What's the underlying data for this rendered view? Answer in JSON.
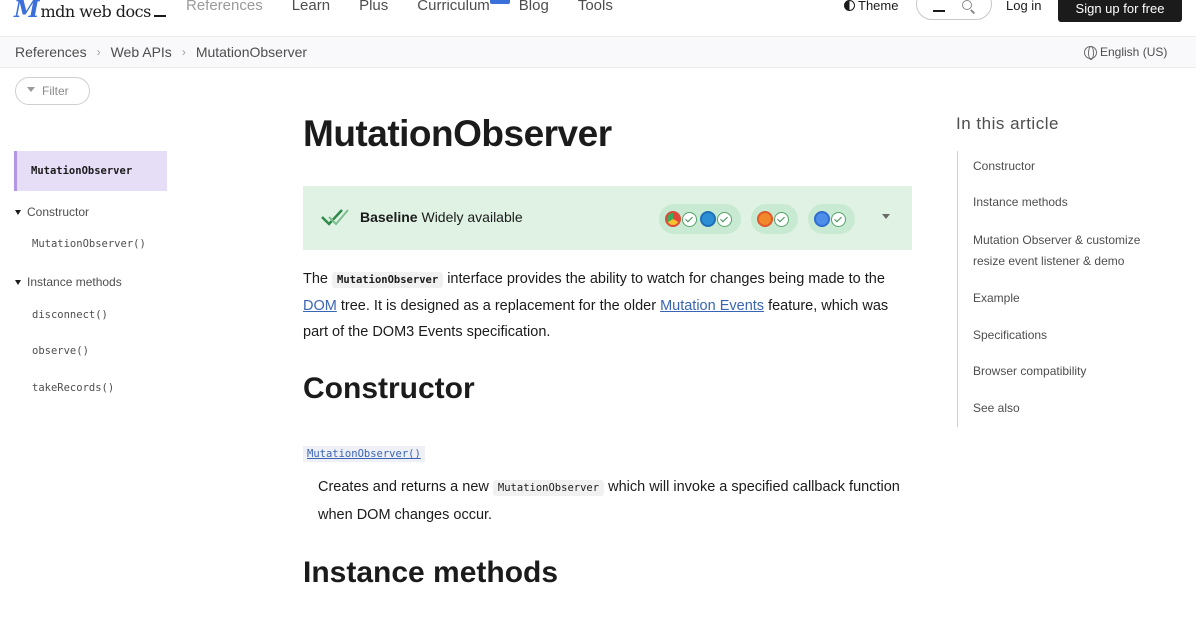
{
  "header": {
    "logo_mark": "M",
    "logo_text": "mdn web docs",
    "nav": [
      "References",
      "Learn",
      "Plus",
      "Curriculum",
      "Blog",
      "Tools"
    ],
    "theme_label": "Theme",
    "login_label": "Log in",
    "signup_label": "Sign up for free"
  },
  "breadcrumb": {
    "items": [
      "References",
      "Web APIs",
      "MutationObserver"
    ],
    "language": "English (US)"
  },
  "sidebar": {
    "filter_placeholder": "Filter",
    "active_item": "MutationObserver",
    "groups": [
      {
        "label": "Constructor",
        "items": [
          "MutationObserver()"
        ]
      },
      {
        "label": "Instance methods",
        "items": [
          "disconnect()",
          "observe()",
          "takeRecords()"
        ]
      }
    ]
  },
  "main": {
    "title": "MutationObserver",
    "baseline": {
      "label": "Baseline",
      "status": "Widely available",
      "browser_icons": [
        "chrome-icon",
        "edge-icon",
        "firefox-icon",
        "safari-icon"
      ],
      "status_color": "#dff2e4"
    },
    "intro": {
      "t1": "The ",
      "code1": "MutationObserver",
      "t2": " interface provides the ability to watch for changes being made to the ",
      "link1": "DOM",
      "t3": " tree. It is designed as a replacement for the older ",
      "link2": "Mutation Events",
      "t4": " feature, which was part of the DOM3 Events specification."
    },
    "constructor_heading": "Constructor",
    "constructor_link": "MutationObserver()",
    "constructor_desc": {
      "t1": "Creates and returns a new ",
      "code": "MutationObserver",
      "t2": " which will invoke a specified callback function when DOM changes occur."
    },
    "methods_heading": "Instance methods"
  },
  "toc": {
    "title": "In this article",
    "items": [
      "Constructor",
      "Instance methods",
      "Mutation Observer & customize resize event listener & demo",
      "Example",
      "Specifications",
      "Browser compatibility",
      "See also"
    ]
  }
}
